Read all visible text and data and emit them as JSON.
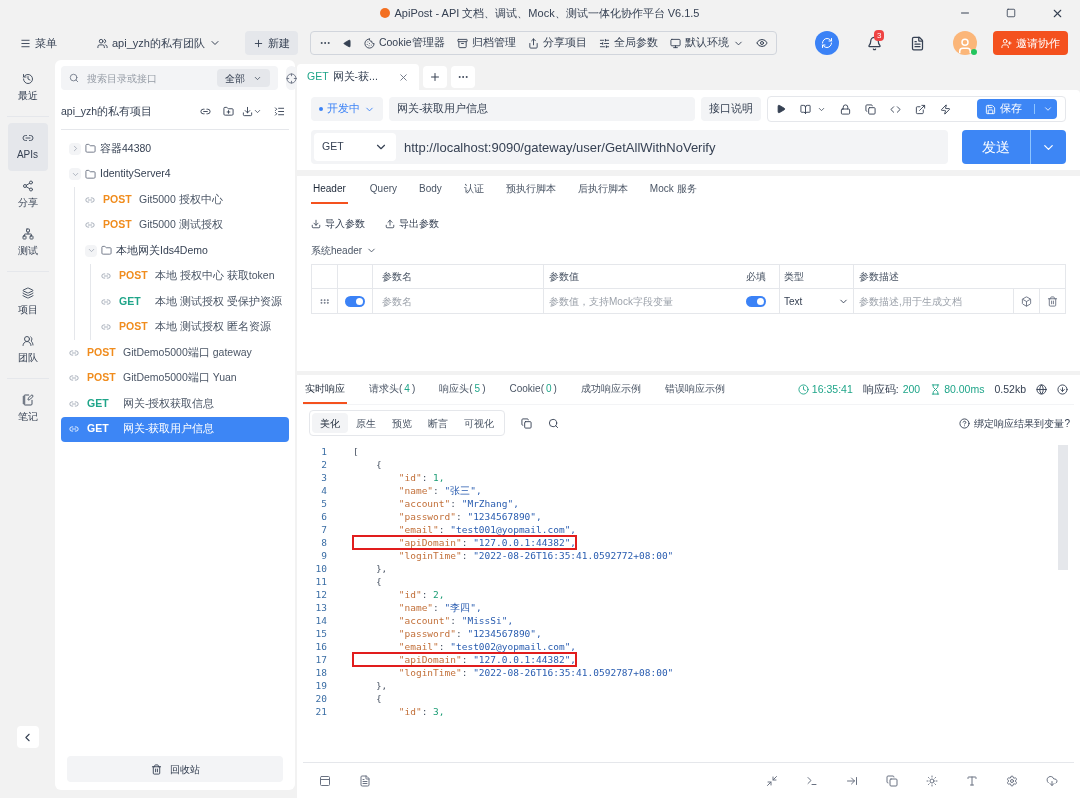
{
  "window": {
    "title": "ApiPost - API 文档、调试、Mock、测试一体化协作平台 V6.1.5"
  },
  "toolbar": {
    "menu": "菜单",
    "team": "api_yzh的私有团队",
    "new": "新建",
    "tools": [
      "Cookie管理器",
      "归档管理",
      "分享项目",
      "全局参数",
      "默认环境"
    ],
    "notifications": "3",
    "invite": "邀请协作"
  },
  "nav": [
    {
      "label": "最近",
      "selected": false
    },
    {
      "label": "APIs",
      "selected": true
    },
    {
      "label": "分享",
      "selected": false
    },
    {
      "label": "测试",
      "selected": false
    },
    {
      "label": "项目",
      "selected": false
    },
    {
      "label": "团队",
      "selected": false
    },
    {
      "label": "笔记",
      "selected": false
    }
  ],
  "sidebar": {
    "search_placeholder": "搜索目录或接口",
    "filter": "全部",
    "project": "api_yzh的私有项目",
    "trash": "回收站",
    "tree": [
      {
        "kind": "folder",
        "name": "容器44380",
        "expanded": false
      },
      {
        "kind": "folder",
        "name": "IdentityServer4",
        "expanded": true,
        "children": [
          {
            "kind": "api",
            "method": "POST",
            "color": "#f08c1d",
            "name": "Git5000 授权中心",
            "selected": false
          },
          {
            "kind": "api",
            "method": "POST",
            "color": "#f08c1d",
            "name": "Git5000 测试授权",
            "selected": false
          },
          {
            "kind": "folder",
            "name": "本地网关Ids4Demo",
            "expanded": true,
            "children": [
              {
                "kind": "api",
                "method": "POST",
                "color": "#f08c1d",
                "name": "本地 授权中心 获取token",
                "selected": false
              },
              {
                "kind": "api",
                "method": "GET",
                "color": "#1fa589",
                "name": "本地 测试授权 受保护资源",
                "selected": false
              },
              {
                "kind": "api",
                "method": "POST",
                "color": "#f08c1d",
                "name": "本地 测试授权 匿名资源",
                "selected": false
              }
            ]
          }
        ]
      },
      {
        "kind": "api",
        "method": "POST",
        "color": "#f08c1d",
        "name": "GitDemo5000端口 gateway",
        "selected": false
      },
      {
        "kind": "api",
        "method": "POST",
        "color": "#f08c1d",
        "name": "GitDemo5000端口 Yuan",
        "selected": false
      },
      {
        "kind": "api",
        "method": "GET",
        "color": "#1fa589",
        "name": "网关-授权获取信息",
        "selected": false
      },
      {
        "kind": "api",
        "method": "GET",
        "name": "网关-获取用户信息",
        "selected": true
      }
    ]
  },
  "request_tabs": [
    {
      "method": "GET",
      "title": "网关-获...",
      "selected": true
    }
  ],
  "request": {
    "status": "开发中",
    "name": "网关-获取用户信息",
    "doc_button": "接口说明",
    "save": "保存",
    "method": "GET",
    "url": "http://localhost:9090/gateway/user/GetAllWithNoVerify",
    "send": "发送"
  },
  "param_tabs": [
    {
      "label": "Header",
      "selected": true
    },
    {
      "label": "Query",
      "selected": false
    },
    {
      "label": "Body",
      "selected": false
    },
    {
      "label": "认证",
      "selected": false
    },
    {
      "label": "预执行脚本",
      "selected": false
    },
    {
      "label": "后执行脚本",
      "selected": false
    },
    {
      "label": "Mock 服务",
      "selected": false
    }
  ],
  "param_actions": [
    "导入参数",
    "导出参数"
  ],
  "system_header": "系统header",
  "params_table": {
    "columns": [
      "参数名",
      "参数值",
      "必填",
      "类型",
      "参数描述"
    ],
    "rows": [
      {
        "name_placeholder": "参数名",
        "value_placeholder": "参数值，支持Mock字段变量",
        "enabled": true,
        "required": true,
        "type": "Text",
        "desc_placeholder": "参数描述,用于生成文档"
      }
    ]
  },
  "response_tabs": [
    {
      "label": "实时响应",
      "selected": true
    },
    {
      "label": "请求头(",
      "count": "4",
      "close": ")",
      "selected": false
    },
    {
      "label": "响应头(",
      "count": "5",
      "close": ")",
      "selected": false
    },
    {
      "label": "Cookie(",
      "count": "0",
      "close": ")",
      "selected": false
    },
    {
      "label": "成功响应示例",
      "selected": false
    },
    {
      "label": "错误响应示例",
      "selected": false
    }
  ],
  "response_meta": {
    "time": "16:35:41",
    "code_label": "响应码:",
    "code": "200",
    "duration": "80.00ms",
    "size": "0.52kb"
  },
  "view_tabs": [
    {
      "label": "美化",
      "selected": true
    },
    {
      "label": "原生",
      "selected": false
    },
    {
      "label": "预览",
      "selected": false
    },
    {
      "label": "断言",
      "selected": false
    },
    {
      "label": "可视化",
      "selected": false
    }
  ],
  "bind_link": "绑定响应结果到变量?",
  "code_lines": [
    {
      "number": "1",
      "text": "[",
      "boxed": false
    },
    {
      "number": "2",
      "text": "    {",
      "boxed": false
    },
    {
      "number": "3",
      "text": "        \"id\": 1,",
      "boxed": false
    },
    {
      "number": "4",
      "text": "        \"name\": \"张三\",",
      "boxed": false
    },
    {
      "number": "5",
      "text": "        \"account\": \"MrZhang\",",
      "boxed": false
    },
    {
      "number": "6",
      "text": "        \"password\": \"1234567890\",",
      "boxed": false
    },
    {
      "number": "7",
      "text": "        \"email\": \"test001@yopmail.com\",",
      "boxed": false
    },
    {
      "number": "8",
      "text": "        \"apiDomain\": \"127.0.0.1:44382\",",
      "boxed": true
    },
    {
      "number": "9",
      "text": "        \"loginTime\": \"2022-08-26T16:35:41.0592772+08:00\"",
      "boxed": false
    },
    {
      "number": "10",
      "text": "    },",
      "boxed": false
    },
    {
      "number": "11",
      "text": "    {",
      "boxed": false
    },
    {
      "number": "12",
      "text": "        \"id\": 2,",
      "boxed": false
    },
    {
      "number": "13",
      "text": "        \"name\": \"李四\",",
      "boxed": false
    },
    {
      "number": "14",
      "text": "        \"account\": \"MissSi\",",
      "boxed": false
    },
    {
      "number": "15",
      "text": "        \"password\": \"1234567890\",",
      "boxed": false
    },
    {
      "number": "16",
      "text": "        \"email\": \"test002@yopmail.com\",",
      "boxed": false
    },
    {
      "number": "17",
      "text": "        \"apiDomain\": \"127.0.0.1:44382\",",
      "boxed": true
    },
    {
      "number": "18",
      "text": "        \"loginTime\": \"2022-08-26T16:35:41.0592787+08:00\"",
      "boxed": false
    },
    {
      "number": "19",
      "text": "    },",
      "boxed": false
    },
    {
      "number": "20",
      "text": "    {",
      "boxed": false
    },
    {
      "number": "21",
      "text": "        \"id\": 3,",
      "boxed": false
    }
  ]
}
